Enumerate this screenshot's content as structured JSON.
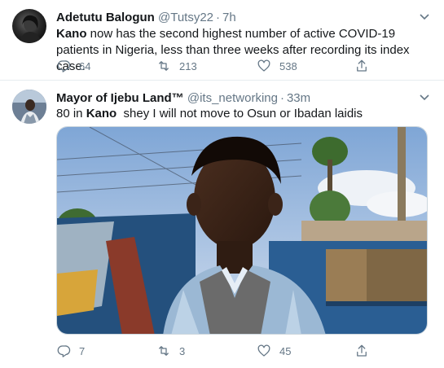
{
  "tweets": [
    {
      "name": "Adetutu Balogun",
      "handle": "@Tutsy22",
      "time": "7h",
      "text_bold": "Kano",
      "text_rest": " now has the second highest number of active COVID-19 patients in Nigeria, less than three weeks after recording its index case.",
      "replies": "64",
      "retweets": "213",
      "likes": "538"
    },
    {
      "name": "Mayor of Ijebu Land™",
      "handle": "@its_networking",
      "time": "33m",
      "text_pre": "80 in ",
      "text_bold": "Kano",
      "text_rest": "  shey I will not move to Osun or Ibadan laidis",
      "replies": "7",
      "retweets": "3",
      "likes": "45"
    }
  ],
  "icons": {
    "caret": "chevron-down-icon",
    "reply": "reply-icon",
    "retweet": "retweet-icon",
    "like": "heart-icon",
    "share": "share-icon"
  },
  "colors": {
    "text": "#14171a",
    "muted": "#657786",
    "divider": "#e6ecf0"
  }
}
